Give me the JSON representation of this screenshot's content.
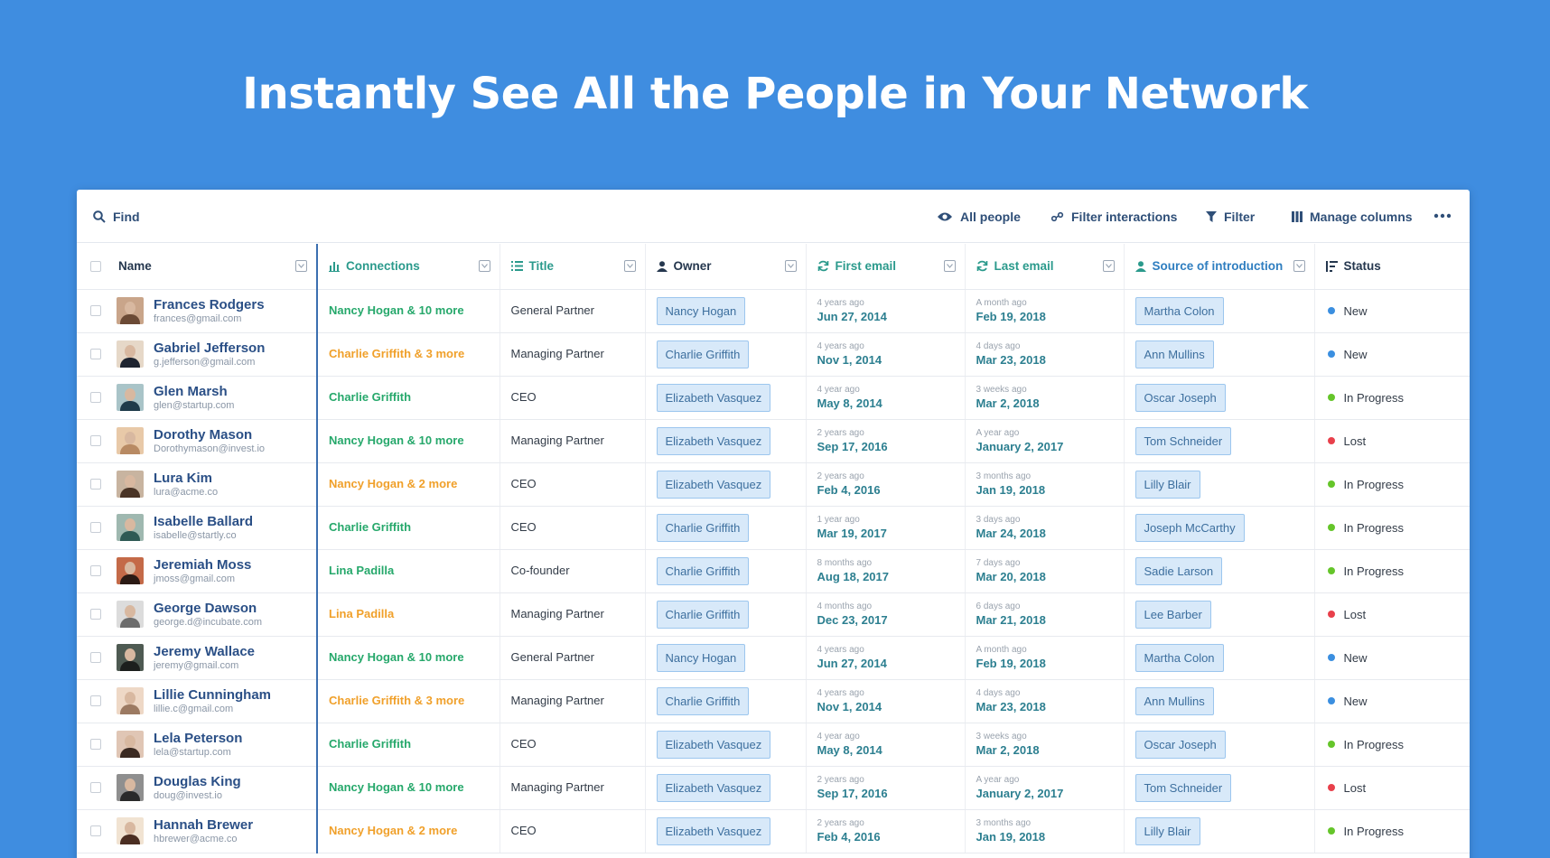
{
  "headline": "Instantly See All the People in Your Network",
  "toolbar": {
    "find_label": "Find",
    "all_people_label": "All people",
    "filter_interactions_label": "Filter interactions",
    "filter_label": "Filter",
    "manage_columns_label": "Manage columns",
    "more_icon": "ellipsis-icon"
  },
  "colors": {
    "background": "#3f8de0",
    "link_blue": "#2a4f86",
    "connection_green": "#26a86b",
    "connection_orange": "#f0a02a",
    "date_teal": "#2c7f90",
    "tag_bg": "#d8e9f9",
    "status_new": "#3b8fe0",
    "status_in_progress": "#65c52a",
    "status_lost": "#e8404b"
  },
  "columns": {
    "name": "Name",
    "connections": "Connections",
    "title": "Title",
    "owner": "Owner",
    "first_email": "First email",
    "last_email": "Last email",
    "source": "Source of introduction",
    "status": "Status"
  },
  "rows": [
    {
      "name": "Frances Rodgers",
      "email": "frances@gmail.com",
      "connections": "Nancy Hogan & 10 more",
      "conn_color": "green",
      "title": "General Partner",
      "owner": "Nancy Hogan",
      "first_rel": "4 years ago",
      "first_date": "Jun 27, 2014",
      "last_rel": "A month ago",
      "last_date": "Feb 19, 2018",
      "source": "Martha Colon",
      "status": "New",
      "status_color": "#3b8fe0"
    },
    {
      "name": "Gabriel Jefferson",
      "email": "g.jefferson@gmail.com",
      "connections": "Charlie Griffith & 3 more",
      "conn_color": "orange",
      "title": "Managing Partner",
      "owner": "Charlie Griffith",
      "first_rel": "4 years ago",
      "first_date": "Nov 1, 2014",
      "last_rel": "4 days ago",
      "last_date": "Mar 23, 2018",
      "source": "Ann Mullins",
      "status": "New",
      "status_color": "#3b8fe0"
    },
    {
      "name": "Glen Marsh",
      "email": "glen@startup.com",
      "connections": "Charlie Griffith",
      "conn_color": "green",
      "title": "CEO",
      "owner": "Elizabeth Vasquez",
      "first_rel": "4 year ago",
      "first_date": "May 8, 2014",
      "last_rel": "3 weeks ago",
      "last_date": "Mar 2, 2018",
      "source": "Oscar Joseph",
      "status": "In Progress",
      "status_color": "#65c52a"
    },
    {
      "name": "Dorothy Mason",
      "email": "Dorothymason@invest.io",
      "connections": "Nancy Hogan & 10 more",
      "conn_color": "green",
      "title": "Managing Partner",
      "owner": "Elizabeth Vasquez",
      "first_rel": "2 years ago",
      "first_date": "Sep 17, 2016",
      "last_rel": "A year ago",
      "last_date": "January 2, 2017",
      "source": "Tom Schneider",
      "status": "Lost",
      "status_color": "#e8404b"
    },
    {
      "name": "Lura Kim",
      "email": "lura@acme.co",
      "connections": "Nancy Hogan & 2 more",
      "conn_color": "orange",
      "title": "CEO",
      "owner": "Elizabeth Vasquez",
      "first_rel": "2 years ago",
      "first_date": "Feb 4, 2016",
      "last_rel": "3 months ago",
      "last_date": "Jan 19, 2018",
      "source": "Lilly Blair",
      "status": "In Progress",
      "status_color": "#65c52a"
    },
    {
      "name": "Isabelle Ballard",
      "email": "isabelle@startly.co",
      "connections": "Charlie Griffith",
      "conn_color": "green",
      "title": "CEO",
      "owner": "Charlie Griffith",
      "first_rel": "1 year ago",
      "first_date": "Mar 19, 2017",
      "last_rel": "3 days ago",
      "last_date": "Mar 24, 2018",
      "source": "Joseph McCarthy",
      "status": "In Progress",
      "status_color": "#65c52a"
    },
    {
      "name": "Jeremiah Moss",
      "email": "jmoss@gmail.com",
      "connections": "Lina Padilla",
      "conn_color": "green",
      "title": "Co-founder",
      "owner": "Charlie Griffith",
      "first_rel": "8 months ago",
      "first_date": "Aug 18, 2017",
      "last_rel": "7 days ago",
      "last_date": "Mar 20, 2018",
      "source": "Sadie Larson",
      "status": "In Progress",
      "status_color": "#65c52a"
    },
    {
      "name": "George Dawson",
      "email": "george.d@incubate.com",
      "connections": "Lina Padilla",
      "conn_color": "orange",
      "title": "Managing Partner",
      "owner": "Charlie Griffith",
      "first_rel": "4 months ago",
      "first_date": "Dec 23, 2017",
      "last_rel": "6 days ago",
      "last_date": "Mar 21, 2018",
      "source": "Lee Barber",
      "status": "Lost",
      "status_color": "#e8404b"
    },
    {
      "name": "Jeremy Wallace",
      "email": "jeremy@gmail.com",
      "connections": "Nancy Hogan & 10 more",
      "conn_color": "green",
      "title": "General Partner",
      "owner": "Nancy Hogan",
      "first_rel": "4 years ago",
      "first_date": "Jun 27, 2014",
      "last_rel": "A month ago",
      "last_date": "Feb 19, 2018",
      "source": "Martha Colon",
      "status": "New",
      "status_color": "#3b8fe0"
    },
    {
      "name": "Lillie Cunningham",
      "email": "lillie.c@gmail.com",
      "connections": "Charlie Griffith & 3 more",
      "conn_color": "orange",
      "title": "Managing Partner",
      "owner": "Charlie Griffith",
      "first_rel": "4 years ago",
      "first_date": "Nov 1, 2014",
      "last_rel": "4 days ago",
      "last_date": "Mar 23, 2018",
      "source": "Ann Mullins",
      "status": "New",
      "status_color": "#3b8fe0"
    },
    {
      "name": "Lela Peterson",
      "email": "lela@startup.com",
      "connections": "Charlie Griffith",
      "conn_color": "green",
      "title": "CEO",
      "owner": "Elizabeth Vasquez",
      "first_rel": "4 year ago",
      "first_date": "May 8, 2014",
      "last_rel": "3 weeks ago",
      "last_date": "Mar 2, 2018",
      "source": "Oscar Joseph",
      "status": "In Progress",
      "status_color": "#65c52a"
    },
    {
      "name": "Douglas King",
      "email": "doug@invest.io",
      "connections": "Nancy Hogan & 10 more",
      "conn_color": "green",
      "title": "Managing Partner",
      "owner": "Elizabeth Vasquez",
      "first_rel": "2 years ago",
      "first_date": "Sep 17, 2016",
      "last_rel": "A year ago",
      "last_date": "January 2, 2017",
      "source": "Tom Schneider",
      "status": "Lost",
      "status_color": "#e8404b"
    },
    {
      "name": "Hannah Brewer",
      "email": "hbrewer@acme.co",
      "connections": "Nancy Hogan & 2 more",
      "conn_color": "orange",
      "title": "CEO",
      "owner": "Elizabeth Vasquez",
      "first_rel": "2 years ago",
      "first_date": "Feb 4, 2016",
      "last_rel": "3 months ago",
      "last_date": "Jan 19, 2018",
      "source": "Lilly Blair",
      "status": "In Progress",
      "status_color": "#65c52a"
    }
  ]
}
